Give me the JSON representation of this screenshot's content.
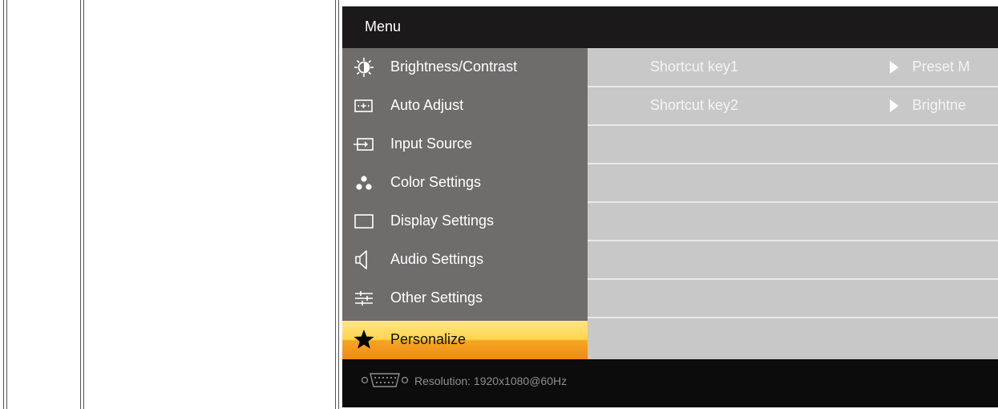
{
  "osd": {
    "title": "Menu",
    "menu_items": [
      {
        "label": "Brightness/Contrast",
        "icon": "brightness-icon"
      },
      {
        "label": "Auto Adjust",
        "icon": "auto-adjust-icon"
      },
      {
        "label": "Input Source",
        "icon": "input-source-icon"
      },
      {
        "label": "Color Settings",
        "icon": "color-settings-icon"
      },
      {
        "label": "Display Settings",
        "icon": "display-settings-icon"
      },
      {
        "label": "Audio Settings",
        "icon": "audio-settings-icon"
      },
      {
        "label": "Other Settings",
        "icon": "other-settings-icon"
      },
      {
        "label": "Personalize",
        "icon": "star-icon",
        "selected": true
      }
    ],
    "submenu": [
      {
        "label": "Shortcut key1",
        "value": "Preset M"
      },
      {
        "label": "Shortcut key2",
        "value": "Brightne"
      }
    ],
    "footer": {
      "resolution": "Resolution:  1920x1080@60Hz",
      "icon": "vga-connector-icon"
    },
    "colors": {
      "menu_bg": "#6f6c6c",
      "submenu_bg": "#c8c8c8",
      "highlight_top": "#ffe58a",
      "highlight_bottom": "#f08a14"
    }
  }
}
